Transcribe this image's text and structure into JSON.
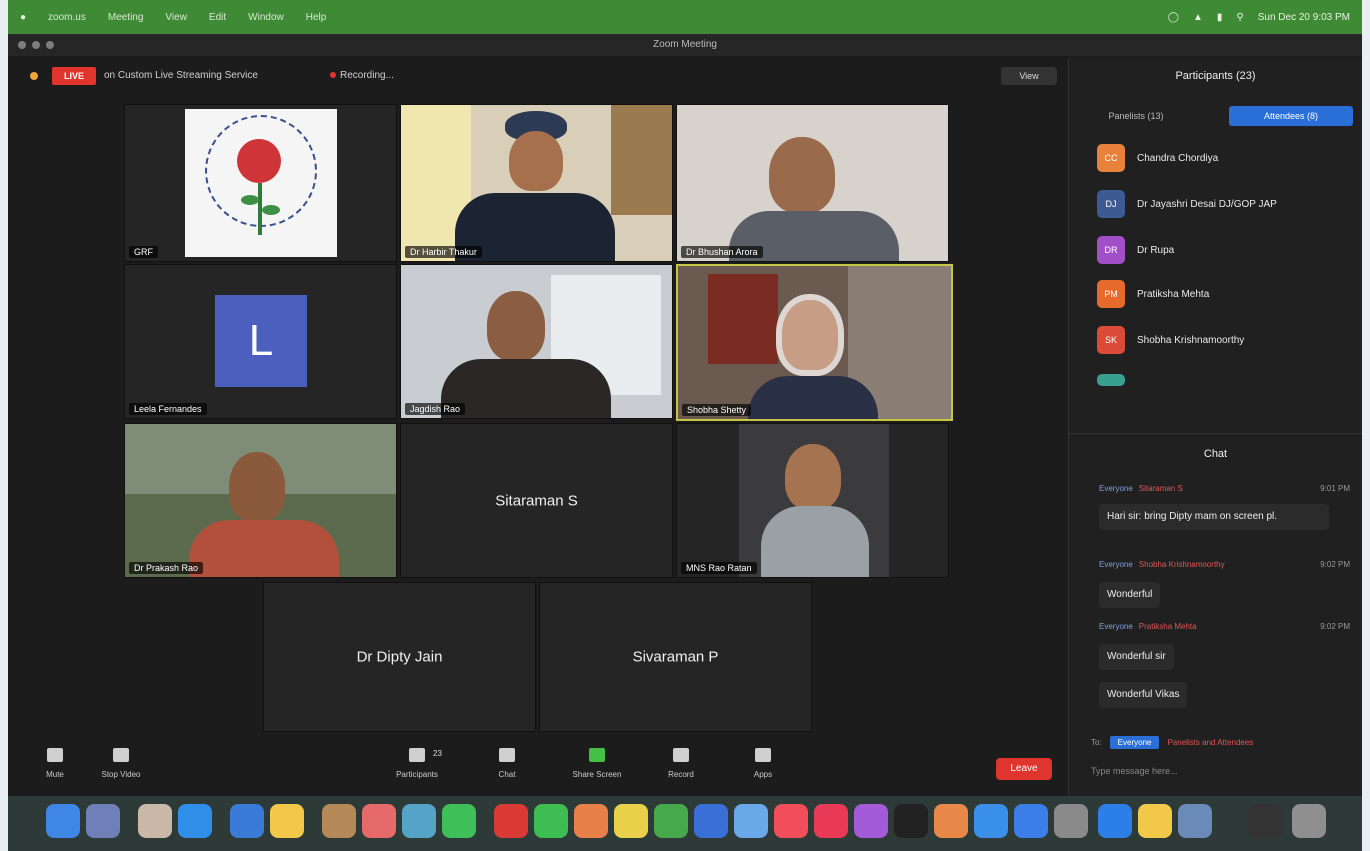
{
  "menubar": {
    "items": [
      "zoom.us",
      "Meeting",
      "View",
      "Edit",
      "Window",
      "Help"
    ],
    "clock": "Sun Dec 20 9:03 PM"
  },
  "window": {
    "title": "Zoom Meeting"
  },
  "topbar": {
    "live_badge": "LIVE",
    "stream_label": "on Custom Live Streaming Service",
    "recording_label": "Recording...",
    "view_label": "View"
  },
  "gallery": {
    "tiles": [
      {
        "name": "GRF"
      },
      {
        "name": "Dr Harbir Thakur"
      },
      {
        "name": "Dr Bhushan Arora"
      },
      {
        "name": "Leela Fernandes",
        "initial": "L"
      },
      {
        "name": "Jagdish Rao"
      },
      {
        "name": "Shobha Shetty"
      },
      {
        "name": "Dr Prakash Rao"
      },
      {
        "name": "",
        "center": "Sitaraman S"
      },
      {
        "name": "MNS Rao Ratan"
      },
      {
        "name": "",
        "center": "Dr Dipty Jain"
      },
      {
        "name": "",
        "center": "Sivaraman P"
      }
    ]
  },
  "controls": {
    "items": [
      "Mute",
      "Stop Video",
      "Participants",
      "Chat",
      "Share Screen",
      "Record",
      "Apps"
    ],
    "participants_count": "23",
    "end_label": "Leave"
  },
  "panel": {
    "title": "Participants (23)",
    "tab_panelists": "Panelists (13)",
    "tab_attendees": "Attendees (8)",
    "participants": [
      {
        "initials": "CC",
        "name": "Chandra Chordiya",
        "color": "#e8823a"
      },
      {
        "initials": "DJ",
        "name": "Dr Jayashri Desai DJ/GOP JAP",
        "color": "#3d5a92"
      },
      {
        "initials": "DR",
        "name": "Dr Rupa",
        "color": "#a04fc6"
      },
      {
        "initials": "PM",
        "name": "Pratiksha Mehta",
        "color": "#e56a2b"
      },
      {
        "initials": "SK",
        "name": "Shobha Krishnamoorthy",
        "color": "#d94b36"
      }
    ],
    "chat_title": "Chat",
    "chat": [
      {
        "from": "Sitaraman S",
        "to": "Everyone",
        "time": "9:01 PM",
        "text": "Hari sir: bring Dipty mam on screen pl."
      },
      {
        "from": "Shobha Krishnamoorthy",
        "to": "Everyone",
        "time": "9:02 PM",
        "text": "Wonderful"
      },
      {
        "from": "Pratiksha Mehta",
        "to": "Everyone",
        "time": "9:02 PM",
        "text": "Wonderful sir"
      },
      {
        "from": "",
        "to": "",
        "time": "",
        "text": "Wonderful Vikas"
      }
    ],
    "to_label": "To:",
    "to_button": "Everyone",
    "to_target": "Panelists and Attendees",
    "chat_placeholder": "Type message here..."
  }
}
